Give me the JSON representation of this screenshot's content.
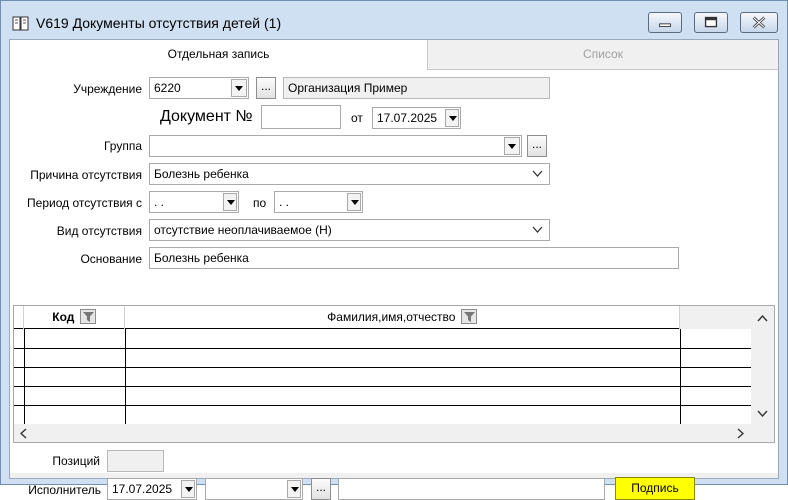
{
  "window": {
    "title": "V619 Документы отсутствия  детей (1)",
    "icon": "book-icon"
  },
  "tabs": [
    {
      "label": "Отдельная запись",
      "active": true
    },
    {
      "label": "Список",
      "active": false
    }
  ],
  "form": {
    "institution_label": "Учреждение",
    "institution_code": "6220",
    "institution_name": "Организация Пример",
    "document_label": "Документ №",
    "document_number": "",
    "date_from_label": "от",
    "document_date": "17.07.2025",
    "group_label": "Группа",
    "group_value": "",
    "reason_label": "Причина отсутствия",
    "reason_value": "Болезнь ребенка",
    "period_label": "Период отсутствия с",
    "period_from": " .  .",
    "period_to_label": "по",
    "period_to": " .  .",
    "absence_type_label": "Вид отсутствия",
    "absence_type_value": "отсутствие неоплачиваемое (Н)",
    "basis_label": "Основание",
    "basis_value": "Болезнь ребенка"
  },
  "grid": {
    "columns": [
      {
        "label": "Код",
        "filter_icon": "filter-icon"
      },
      {
        "label": "Фамилия,имя,отчество",
        "filter_icon": "filter-icon"
      }
    ],
    "rows": [
      {
        "code": "",
        "name": ""
      },
      {
        "code": "",
        "name": ""
      },
      {
        "code": "",
        "name": ""
      },
      {
        "code": "",
        "name": ""
      },
      {
        "code": "",
        "name": ""
      }
    ]
  },
  "footer": {
    "positions_label": "Позиций",
    "positions_value": "",
    "executor_label": "Исполнитель",
    "executor_date": "17.07.2025",
    "executor_select": "",
    "executor_name": "",
    "sign_button": "Подпись"
  },
  "colors": {
    "title_bar": "#cfe0f3",
    "sign_button": "#ffff00"
  }
}
